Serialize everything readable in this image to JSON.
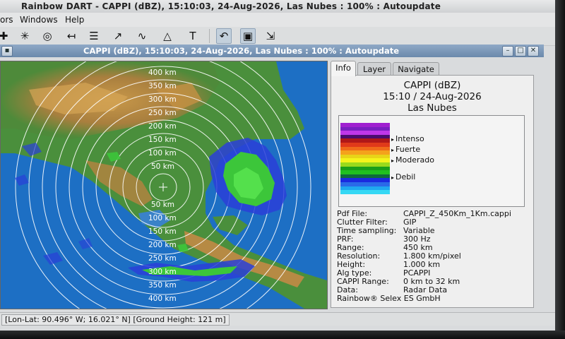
{
  "app": {
    "title": "Rainbow DART - CAPPI (dBZ), 15:10:03, 24-Aug-2026, Las Nubes : 100% : Autoupdate"
  },
  "menu": {
    "items": [
      "ors",
      "Windows",
      "Help"
    ]
  },
  "toolbar": {
    "text_tool_glyph": "T"
  },
  "window": {
    "title": "CAPPI (dBZ), 15:10:03, 24-Aug-2026, Las Nubes : 100% : Autoupdate"
  },
  "map": {
    "range_labels_north": [
      "400 km",
      "350 km",
      "300 km",
      "250 km",
      "200 km",
      "150 km",
      "100 km",
      "50 km"
    ],
    "range_labels_south": [
      "50 km",
      "100 km",
      "150 km",
      "200 km",
      "250 km",
      "300 km",
      "350 km",
      "400 km"
    ],
    "colors": {
      "sea": "#1d6fc4",
      "land_low": "#3f8a3a",
      "land_high": "#b9893f",
      "echo_light": "#3cc63a",
      "echo_weak": "#2a3fd8",
      "echo_mid": "#54e04c"
    }
  },
  "panel": {
    "tabs": [
      "Info",
      "Layer",
      "Navigate"
    ],
    "active_tab": "Info",
    "product": "CAPPI (dBZ)",
    "time_date": "15:10 / 24-Aug-2026",
    "site": "Las Nubes",
    "legend": {
      "labels": [
        "Intenso",
        "Fuerte",
        "Moderado",
        "Debil"
      ],
      "colors": [
        "#a020d0",
        "#7a1fc0",
        "#c037e8",
        "#4a0d6e",
        "#b01818",
        "#e03a1a",
        "#f06a1a",
        "#f4a21c",
        "#e8d418",
        "#f4f41c",
        "#9ada1c",
        "#1a9e1a",
        "#20c020",
        "#0e6a3c",
        "#1a2ae0",
        "#2a6ae8",
        "#20a8f0",
        "#36d8f4"
      ]
    },
    "info": [
      {
        "key": "Pdf File:",
        "value": "CAPPI_Z_450Km_1Km.cappi"
      },
      {
        "key": "Clutter Filter:",
        "value": "GIP"
      },
      {
        "key": "Time sampling:",
        "value": "Variable"
      },
      {
        "key": "PRF:",
        "value": "300 Hz"
      },
      {
        "key": "Range:",
        "value": "450 km"
      },
      {
        "key": "Resolution:",
        "value": "1.800 km/pixel"
      },
      {
        "key": "Height:",
        "value": "1.000 km"
      },
      {
        "key": "Alg type:",
        "value": "PCAPPI"
      },
      {
        "key": "CAPPI Range:",
        "value": "0 km to 32 km"
      },
      {
        "key": "Data:",
        "value": "Radar Data"
      }
    ],
    "footer": "Rainbow® Selex ES GmbH"
  },
  "status": {
    "text": "[Lon-Lat: 90.496° W; 16.021° N] [Ground Height: 121 m]"
  }
}
